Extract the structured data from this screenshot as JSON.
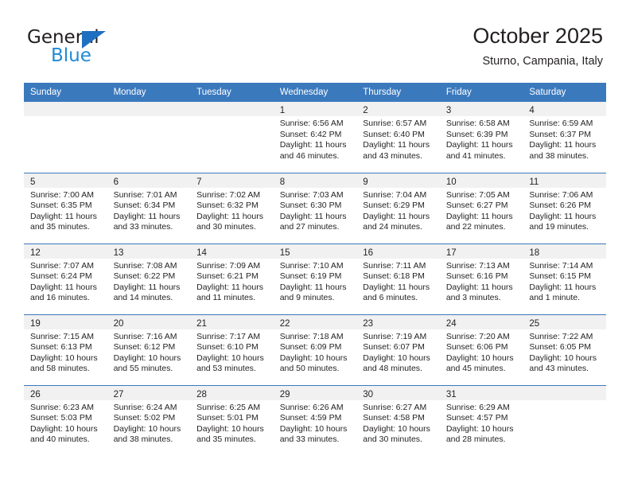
{
  "brand": {
    "name_dark": "General",
    "name_blue": "Blue",
    "accent_blue": "#1f6fc0",
    "light_blue": "#1f8ad6"
  },
  "header": {
    "title": "October 2025",
    "subtitle": "Sturno, Campania, Italy"
  },
  "theme": {
    "header_bar": "#3b79bd",
    "daynum_band": "#f1f1f1",
    "text": "#231f20"
  },
  "weekday_headers": [
    "Sunday",
    "Monday",
    "Tuesday",
    "Wednesday",
    "Thursday",
    "Friday",
    "Saturday"
  ],
  "weeks": [
    [
      {
        "day": "",
        "sunrise": "",
        "sunset": "",
        "daylight_1": "",
        "daylight_2": ""
      },
      {
        "day": "",
        "sunrise": "",
        "sunset": "",
        "daylight_1": "",
        "daylight_2": ""
      },
      {
        "day": "",
        "sunrise": "",
        "sunset": "",
        "daylight_1": "",
        "daylight_2": ""
      },
      {
        "day": "1",
        "sunrise": "Sunrise: 6:56 AM",
        "sunset": "Sunset: 6:42 PM",
        "daylight_1": "Daylight: 11 hours",
        "daylight_2": "and 46 minutes."
      },
      {
        "day": "2",
        "sunrise": "Sunrise: 6:57 AM",
        "sunset": "Sunset: 6:40 PM",
        "daylight_1": "Daylight: 11 hours",
        "daylight_2": "and 43 minutes."
      },
      {
        "day": "3",
        "sunrise": "Sunrise: 6:58 AM",
        "sunset": "Sunset: 6:39 PM",
        "daylight_1": "Daylight: 11 hours",
        "daylight_2": "and 41 minutes."
      },
      {
        "day": "4",
        "sunrise": "Sunrise: 6:59 AM",
        "sunset": "Sunset: 6:37 PM",
        "daylight_1": "Daylight: 11 hours",
        "daylight_2": "and 38 minutes."
      }
    ],
    [
      {
        "day": "5",
        "sunrise": "Sunrise: 7:00 AM",
        "sunset": "Sunset: 6:35 PM",
        "daylight_1": "Daylight: 11 hours",
        "daylight_2": "and 35 minutes."
      },
      {
        "day": "6",
        "sunrise": "Sunrise: 7:01 AM",
        "sunset": "Sunset: 6:34 PM",
        "daylight_1": "Daylight: 11 hours",
        "daylight_2": "and 33 minutes."
      },
      {
        "day": "7",
        "sunrise": "Sunrise: 7:02 AM",
        "sunset": "Sunset: 6:32 PM",
        "daylight_1": "Daylight: 11 hours",
        "daylight_2": "and 30 minutes."
      },
      {
        "day": "8",
        "sunrise": "Sunrise: 7:03 AM",
        "sunset": "Sunset: 6:30 PM",
        "daylight_1": "Daylight: 11 hours",
        "daylight_2": "and 27 minutes."
      },
      {
        "day": "9",
        "sunrise": "Sunrise: 7:04 AM",
        "sunset": "Sunset: 6:29 PM",
        "daylight_1": "Daylight: 11 hours",
        "daylight_2": "and 24 minutes."
      },
      {
        "day": "10",
        "sunrise": "Sunrise: 7:05 AM",
        "sunset": "Sunset: 6:27 PM",
        "daylight_1": "Daylight: 11 hours",
        "daylight_2": "and 22 minutes."
      },
      {
        "day": "11",
        "sunrise": "Sunrise: 7:06 AM",
        "sunset": "Sunset: 6:26 PM",
        "daylight_1": "Daylight: 11 hours",
        "daylight_2": "and 19 minutes."
      }
    ],
    [
      {
        "day": "12",
        "sunrise": "Sunrise: 7:07 AM",
        "sunset": "Sunset: 6:24 PM",
        "daylight_1": "Daylight: 11 hours",
        "daylight_2": "and 16 minutes."
      },
      {
        "day": "13",
        "sunrise": "Sunrise: 7:08 AM",
        "sunset": "Sunset: 6:22 PM",
        "daylight_1": "Daylight: 11 hours",
        "daylight_2": "and 14 minutes."
      },
      {
        "day": "14",
        "sunrise": "Sunrise: 7:09 AM",
        "sunset": "Sunset: 6:21 PM",
        "daylight_1": "Daylight: 11 hours",
        "daylight_2": "and 11 minutes."
      },
      {
        "day": "15",
        "sunrise": "Sunrise: 7:10 AM",
        "sunset": "Sunset: 6:19 PM",
        "daylight_1": "Daylight: 11 hours",
        "daylight_2": "and 9 minutes."
      },
      {
        "day": "16",
        "sunrise": "Sunrise: 7:11 AM",
        "sunset": "Sunset: 6:18 PM",
        "daylight_1": "Daylight: 11 hours",
        "daylight_2": "and 6 minutes."
      },
      {
        "day": "17",
        "sunrise": "Sunrise: 7:13 AM",
        "sunset": "Sunset: 6:16 PM",
        "daylight_1": "Daylight: 11 hours",
        "daylight_2": "and 3 minutes."
      },
      {
        "day": "18",
        "sunrise": "Sunrise: 7:14 AM",
        "sunset": "Sunset: 6:15 PM",
        "daylight_1": "Daylight: 11 hours",
        "daylight_2": "and 1 minute."
      }
    ],
    [
      {
        "day": "19",
        "sunrise": "Sunrise: 7:15 AM",
        "sunset": "Sunset: 6:13 PM",
        "daylight_1": "Daylight: 10 hours",
        "daylight_2": "and 58 minutes."
      },
      {
        "day": "20",
        "sunrise": "Sunrise: 7:16 AM",
        "sunset": "Sunset: 6:12 PM",
        "daylight_1": "Daylight: 10 hours",
        "daylight_2": "and 55 minutes."
      },
      {
        "day": "21",
        "sunrise": "Sunrise: 7:17 AM",
        "sunset": "Sunset: 6:10 PM",
        "daylight_1": "Daylight: 10 hours",
        "daylight_2": "and 53 minutes."
      },
      {
        "day": "22",
        "sunrise": "Sunrise: 7:18 AM",
        "sunset": "Sunset: 6:09 PM",
        "daylight_1": "Daylight: 10 hours",
        "daylight_2": "and 50 minutes."
      },
      {
        "day": "23",
        "sunrise": "Sunrise: 7:19 AM",
        "sunset": "Sunset: 6:07 PM",
        "daylight_1": "Daylight: 10 hours",
        "daylight_2": "and 48 minutes."
      },
      {
        "day": "24",
        "sunrise": "Sunrise: 7:20 AM",
        "sunset": "Sunset: 6:06 PM",
        "daylight_1": "Daylight: 10 hours",
        "daylight_2": "and 45 minutes."
      },
      {
        "day": "25",
        "sunrise": "Sunrise: 7:22 AM",
        "sunset": "Sunset: 6:05 PM",
        "daylight_1": "Daylight: 10 hours",
        "daylight_2": "and 43 minutes."
      }
    ],
    [
      {
        "day": "26",
        "sunrise": "Sunrise: 6:23 AM",
        "sunset": "Sunset: 5:03 PM",
        "daylight_1": "Daylight: 10 hours",
        "daylight_2": "and 40 minutes."
      },
      {
        "day": "27",
        "sunrise": "Sunrise: 6:24 AM",
        "sunset": "Sunset: 5:02 PM",
        "daylight_1": "Daylight: 10 hours",
        "daylight_2": "and 38 minutes."
      },
      {
        "day": "28",
        "sunrise": "Sunrise: 6:25 AM",
        "sunset": "Sunset: 5:01 PM",
        "daylight_1": "Daylight: 10 hours",
        "daylight_2": "and 35 minutes."
      },
      {
        "day": "29",
        "sunrise": "Sunrise: 6:26 AM",
        "sunset": "Sunset: 4:59 PM",
        "daylight_1": "Daylight: 10 hours",
        "daylight_2": "and 33 minutes."
      },
      {
        "day": "30",
        "sunrise": "Sunrise: 6:27 AM",
        "sunset": "Sunset: 4:58 PM",
        "daylight_1": "Daylight: 10 hours",
        "daylight_2": "and 30 minutes."
      },
      {
        "day": "31",
        "sunrise": "Sunrise: 6:29 AM",
        "sunset": "Sunset: 4:57 PM",
        "daylight_1": "Daylight: 10 hours",
        "daylight_2": "and 28 minutes."
      },
      {
        "day": "",
        "sunrise": "",
        "sunset": "",
        "daylight_1": "",
        "daylight_2": ""
      }
    ]
  ]
}
